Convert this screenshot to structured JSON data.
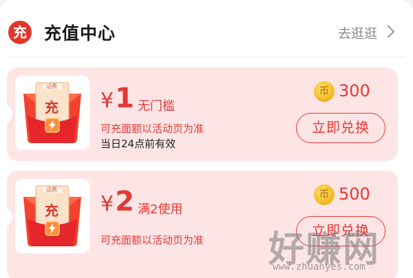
{
  "header": {
    "logo_char": "充",
    "title": "充值中心",
    "more_label": "去逛逛"
  },
  "cards": [
    {
      "thumb_tag": "话费",
      "thumb_char": "充",
      "currency": "¥",
      "amount": "1",
      "condition": "无门槛",
      "description": "可充面额以活动页为准",
      "validity": "当日24点前有效",
      "coin_symbol": "币",
      "points": "300",
      "button_label": "立即兑换"
    },
    {
      "thumb_tag": "话费",
      "thumb_char": "充",
      "currency": "¥",
      "amount": "2",
      "condition": "满2使用",
      "description": "可充面额以活动页为准",
      "coin_symbol": "币",
      "points": "500",
      "button_label": "立即兑换"
    }
  ],
  "watermark": {
    "title": "好赚网",
    "url": "www.zhuanyes.com"
  },
  "colors": {
    "accent": "#e23a37",
    "card_bg": "#fde5e6",
    "coin": "#f1b51c"
  }
}
